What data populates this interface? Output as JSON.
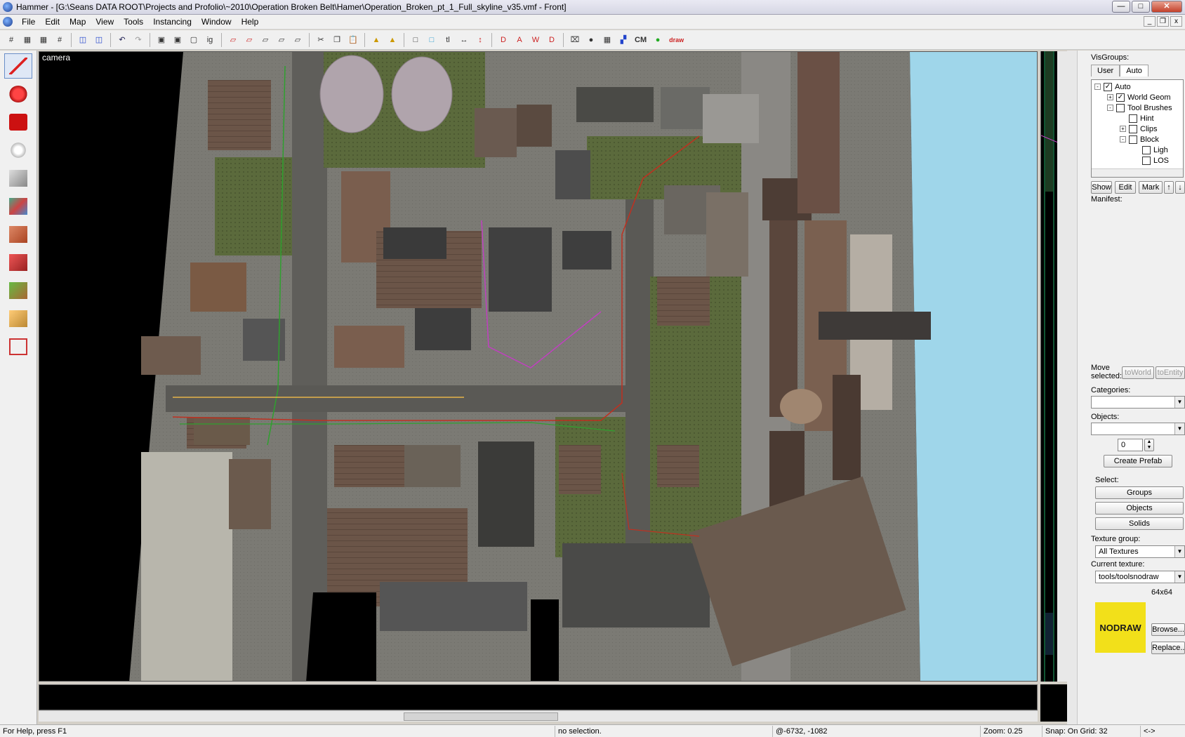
{
  "window": {
    "title": "Hammer - [G:\\Seans DATA ROOT\\Projects and Profolio\\~2010\\Operation Broken Belt\\Hamer\\Operation_Broken_pt_1_Full_skyline_v35.vmf - Front]",
    "controls": [
      "minimize",
      "maximize",
      "close"
    ]
  },
  "menu": [
    "File",
    "Edit",
    "Map",
    "View",
    "Tools",
    "Instancing",
    "Window",
    "Help"
  ],
  "toolbar": {
    "cm_label": "CM",
    "draw_label": "draw"
  },
  "left_tools": [
    {
      "icon": "selection-pointer-icon",
      "color": "#d22"
    },
    {
      "icon": "magnify-icon",
      "color": "#d22"
    },
    {
      "icon": "camera-icon",
      "color": "#c11"
    },
    {
      "icon": "entity-bulb-icon",
      "color": "#eee"
    },
    {
      "icon": "block-tool-icon",
      "color": "#aaa"
    },
    {
      "icon": "texture-application-icon",
      "color": "#4a8"
    },
    {
      "icon": "apply-decal-icon",
      "color": "#b53"
    },
    {
      "icon": "overlay-icon",
      "color": "#c22"
    },
    {
      "icon": "clipping-tool-icon",
      "color": "#5a4"
    },
    {
      "icon": "vertex-tool-icon",
      "color": "#da6"
    },
    {
      "icon": "path-tool-icon",
      "color": "#c33"
    }
  ],
  "viewport": {
    "label": "camera"
  },
  "visgroups": {
    "title": "VisGroups:",
    "tabs": [
      "User",
      "Auto"
    ],
    "selected_tab": "Auto",
    "tree": [
      {
        "label": "Auto",
        "checked": true,
        "expand": "-"
      },
      {
        "label": "World Geom",
        "checked": true,
        "expand": "+"
      },
      {
        "label": "Tool Brushes",
        "checked": false,
        "expand": "-"
      },
      {
        "label": "Hint",
        "checked": false,
        "expand": ""
      },
      {
        "label": "Clips",
        "checked": false,
        "expand": "+"
      },
      {
        "label": "Block",
        "checked": false,
        "expand": "-"
      },
      {
        "label": "Ligh",
        "checked": false,
        "expand": ""
      },
      {
        "label": "LOS",
        "checked": false,
        "expand": ""
      }
    ],
    "buttons": [
      "Show",
      "Edit",
      "Mark"
    ],
    "manifest": "Manifest:"
  },
  "selection": {
    "move_selected": "Move\nselected:",
    "to_world": "toWorld",
    "to_entity": "toEntity",
    "categories_label": "Categories:",
    "objects_label": "Objects:",
    "prefab_count": "0",
    "create_prefab": "Create Prefab",
    "select_label": "Select:",
    "groups": "Groups",
    "objects": "Objects",
    "solids": "Solids"
  },
  "texture": {
    "group_label": "Texture group:",
    "group_value": "All Textures",
    "current_label": "Current texture:",
    "current_value": "tools/toolsnodraw",
    "size": "64x64",
    "preview_text": "NODRAW",
    "browse": "Browse...",
    "replace": "Replace...",
    "colors": {
      "preview": "#f2e01a"
    }
  },
  "status": {
    "help": "For Help, press F1",
    "selection": "no selection.",
    "coords": "@-6732, -1082",
    "zoom": "Zoom: 0.25",
    "snap": "Snap: On Grid: 32",
    "extra": "<->"
  }
}
